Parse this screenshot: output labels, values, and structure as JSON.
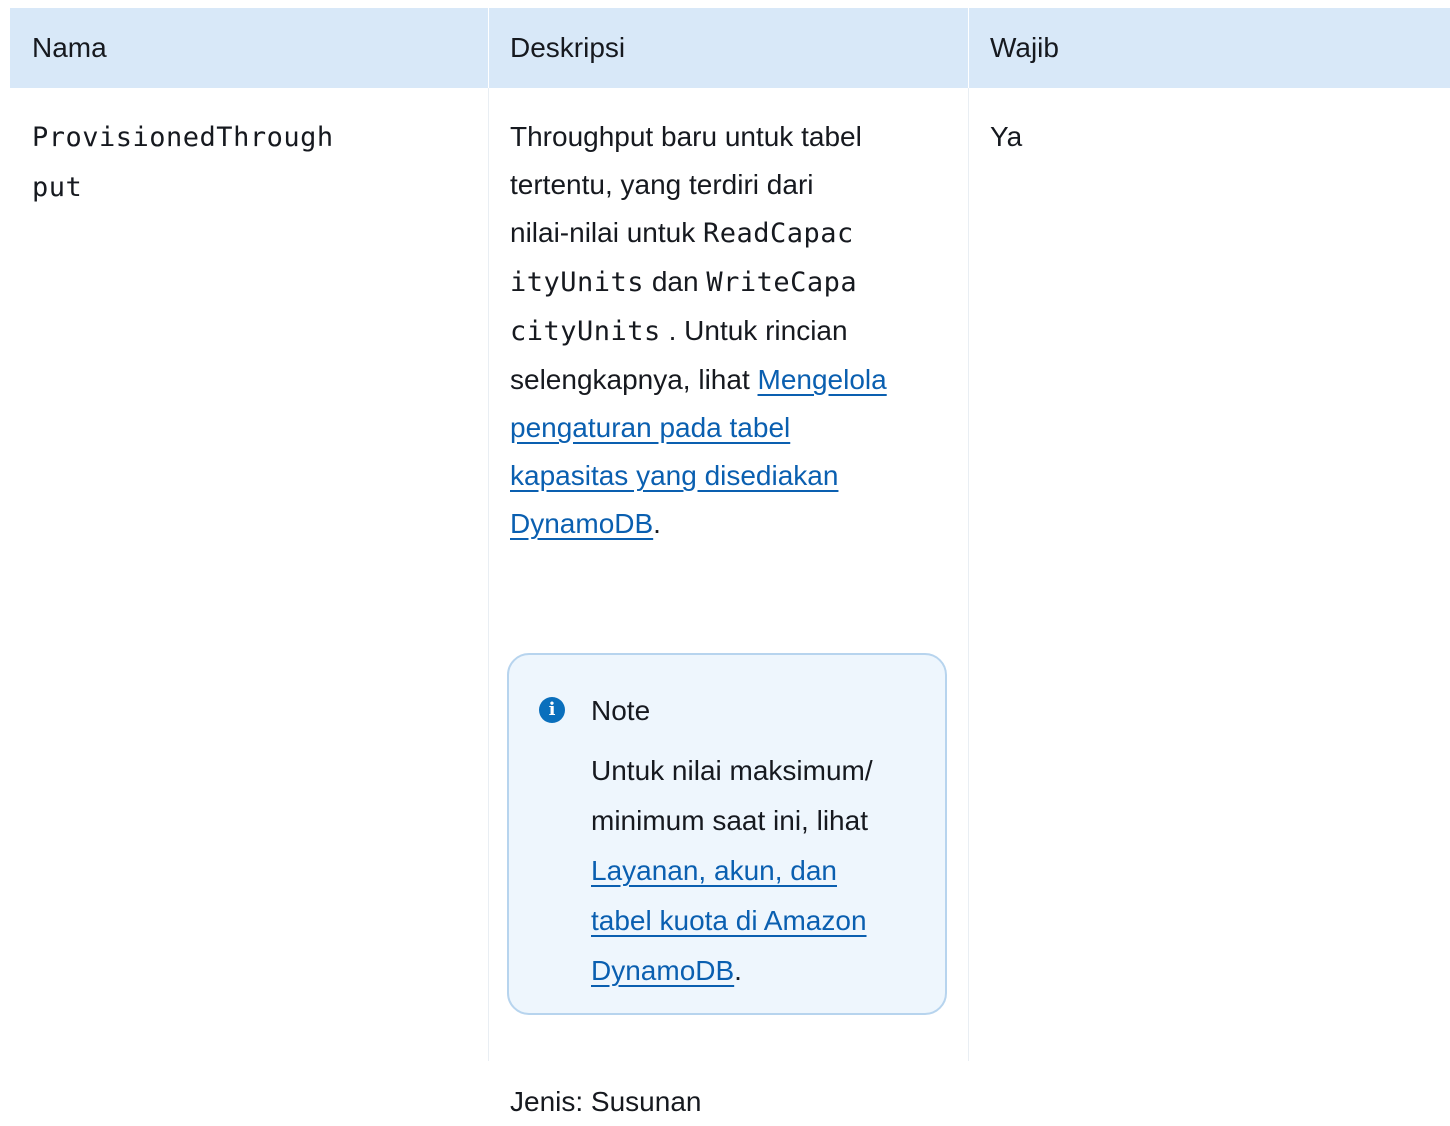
{
  "headers": {
    "name": "Nama",
    "description": "Deskripsi",
    "required": "Wajib"
  },
  "row": {
    "name_line1": "ProvisionedThrough",
    "name_line2": "put",
    "desc_line1": "Throughput baru untuk tabel",
    "desc_line2": "tertentu, yang terdiri dari",
    "desc_line3_text": "nilai-nilai untuk ",
    "desc_line3_code": "ReadCapac",
    "desc_line4_code": "ityUnits",
    "desc_line4_text": " dan ",
    "desc_line4_code2": "WriteCapa",
    "desc_line5_code": "cityUnits",
    "desc_line5_text": " . Untuk rincian",
    "desc_line6_text": "selengkapnya, lihat ",
    "desc_link_line1": "Mengelola",
    "desc_link_line2": "pengaturan pada tabel",
    "desc_link_line3": "kapasitas yang disediakan",
    "desc_link_line4": "DynamoDB",
    "desc_period": ".",
    "required": "Ya",
    "type": "Jenis: Susunan"
  },
  "note": {
    "icon": "info-icon",
    "icon_glyph": "i",
    "title": "Note",
    "body_line1": "Untuk nilai maksimum/",
    "body_line2": "minimum saat ini, lihat",
    "link_line1": "Layanan, akun, dan",
    "link_line2": "tabel kuota di Amazon",
    "link_line3": "DynamoDB",
    "period": "."
  },
  "colors": {
    "header_bg": "#d8e8f8",
    "note_bg": "#eef6fd",
    "note_border": "#b7d4ee",
    "link": "#0a5fb0",
    "icon": "#0a6fbc"
  }
}
